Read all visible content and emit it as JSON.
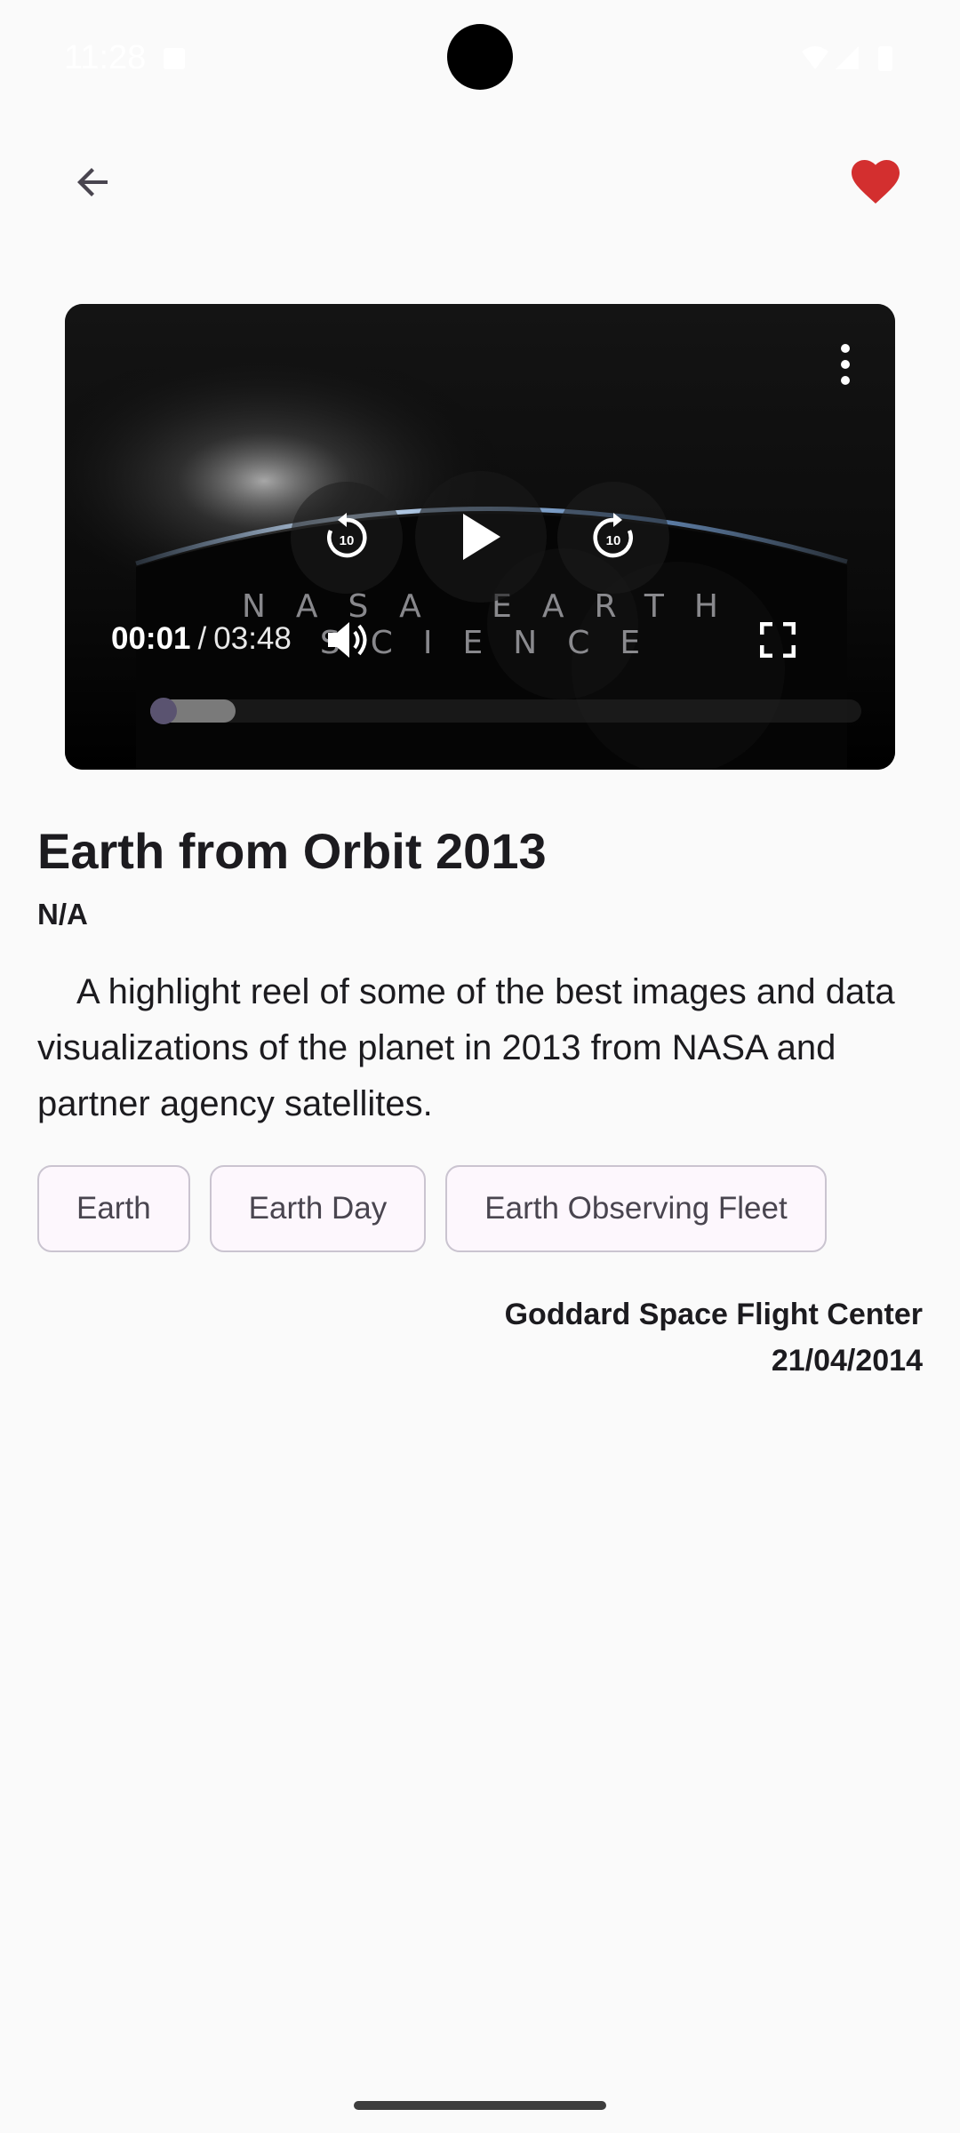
{
  "status_bar": {
    "time": "11:28"
  },
  "video": {
    "watermark": "NASA EARTH SCIENCE",
    "current_time": "00:01",
    "separator": "/",
    "total_time": "03:48",
    "rewind_seconds": "10",
    "forward_seconds": "10",
    "progress_fraction": 0.0045,
    "buffered_fraction": 0.12
  },
  "details": {
    "title": "Earth from Orbit 2013",
    "subtitle": "N/A",
    "description": "A highlight reel of some of the best images and data visualizations of the planet in 2013 from NASA and partner agency satellites.",
    "tags": [
      "Earth",
      "Earth Day",
      "Earth Observing Fleet"
    ],
    "center": "Goddard Space Flight Center",
    "date": "21/04/2014"
  },
  "colors": {
    "favorite": "#d32f2f",
    "chip_border": "#cac4d0",
    "chip_bg": "#fdf7fd",
    "seek_thumb": "#5a5370"
  },
  "icons": {
    "back": "arrow-back-icon",
    "favorite": "heart-icon",
    "more": "more-vert-icon",
    "rewind": "replay-10-icon",
    "play": "play-icon",
    "forward": "forward-10-icon",
    "volume": "volume-icon",
    "fullscreen": "fullscreen-icon"
  }
}
